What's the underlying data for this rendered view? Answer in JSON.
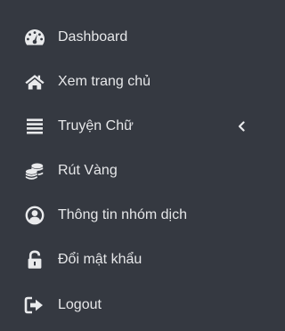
{
  "sidebar": {
    "items": [
      {
        "label": "Dashboard",
        "icon": "tachometer-icon"
      },
      {
        "label": "Xem trang chủ",
        "icon": "home-icon"
      },
      {
        "label": "Truyện Chữ",
        "icon": "list-icon",
        "has_submenu": true
      },
      {
        "label": "Rút Vàng",
        "icon": "coins-icon"
      },
      {
        "label": "Thông tin nhóm dịch",
        "icon": "user-circle-icon"
      },
      {
        "label": "Đổi mật khẩu",
        "icon": "unlock-icon"
      },
      {
        "label": "Logout",
        "icon": "sign-out-icon"
      }
    ]
  },
  "colors": {
    "background": "#353941",
    "text": "#e6e7e9",
    "icon": "#e9eaec"
  }
}
